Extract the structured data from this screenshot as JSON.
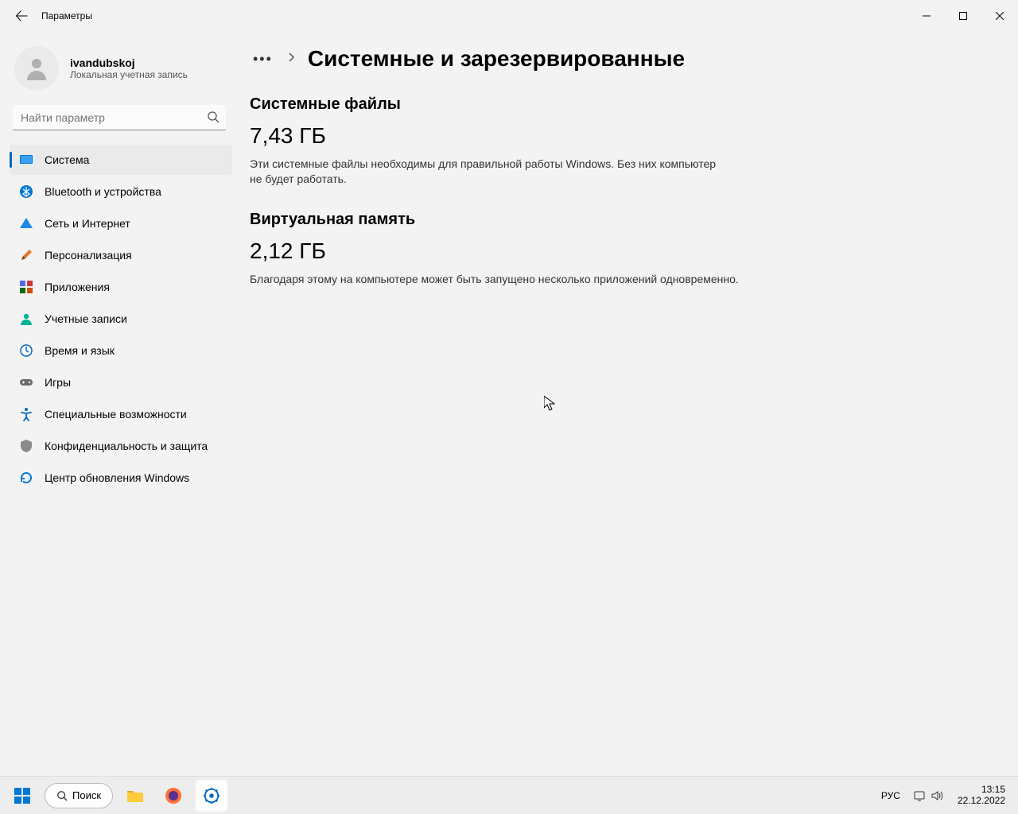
{
  "window": {
    "title": "Параметры"
  },
  "user": {
    "name": "ivandubskoj",
    "sub": "Локальная учетная запись"
  },
  "search": {
    "placeholder": "Найти параметр"
  },
  "nav": {
    "items": [
      {
        "label": "Система",
        "selected": true
      },
      {
        "label": "Bluetooth и устройства"
      },
      {
        "label": "Сеть и Интернет"
      },
      {
        "label": "Персонализация"
      },
      {
        "label": "Приложения"
      },
      {
        "label": "Учетные записи"
      },
      {
        "label": "Время и язык"
      },
      {
        "label": "Игры"
      },
      {
        "label": "Специальные возможности"
      },
      {
        "label": "Конфиденциальность и защита"
      },
      {
        "label": "Центр обновления Windows"
      }
    ]
  },
  "main": {
    "page_title": "Системные и зарезервированные",
    "system_files": {
      "title": "Системные файлы",
      "value": "7,43 ГБ",
      "desc": "Эти системные файлы необходимы для правильной работы Windows. Без них компьютер не будет работать."
    },
    "virtual_memory": {
      "title": "Виртуальная память",
      "value": "2,12 ГБ",
      "desc": "Благодаря этому на компьютере может быть запущено несколько приложений одновременно."
    }
  },
  "taskbar": {
    "search_label": "Поиск",
    "lang": "РУС",
    "time": "13:15",
    "date": "22.12.2022"
  },
  "colors": {
    "accent": "#0067c0"
  }
}
